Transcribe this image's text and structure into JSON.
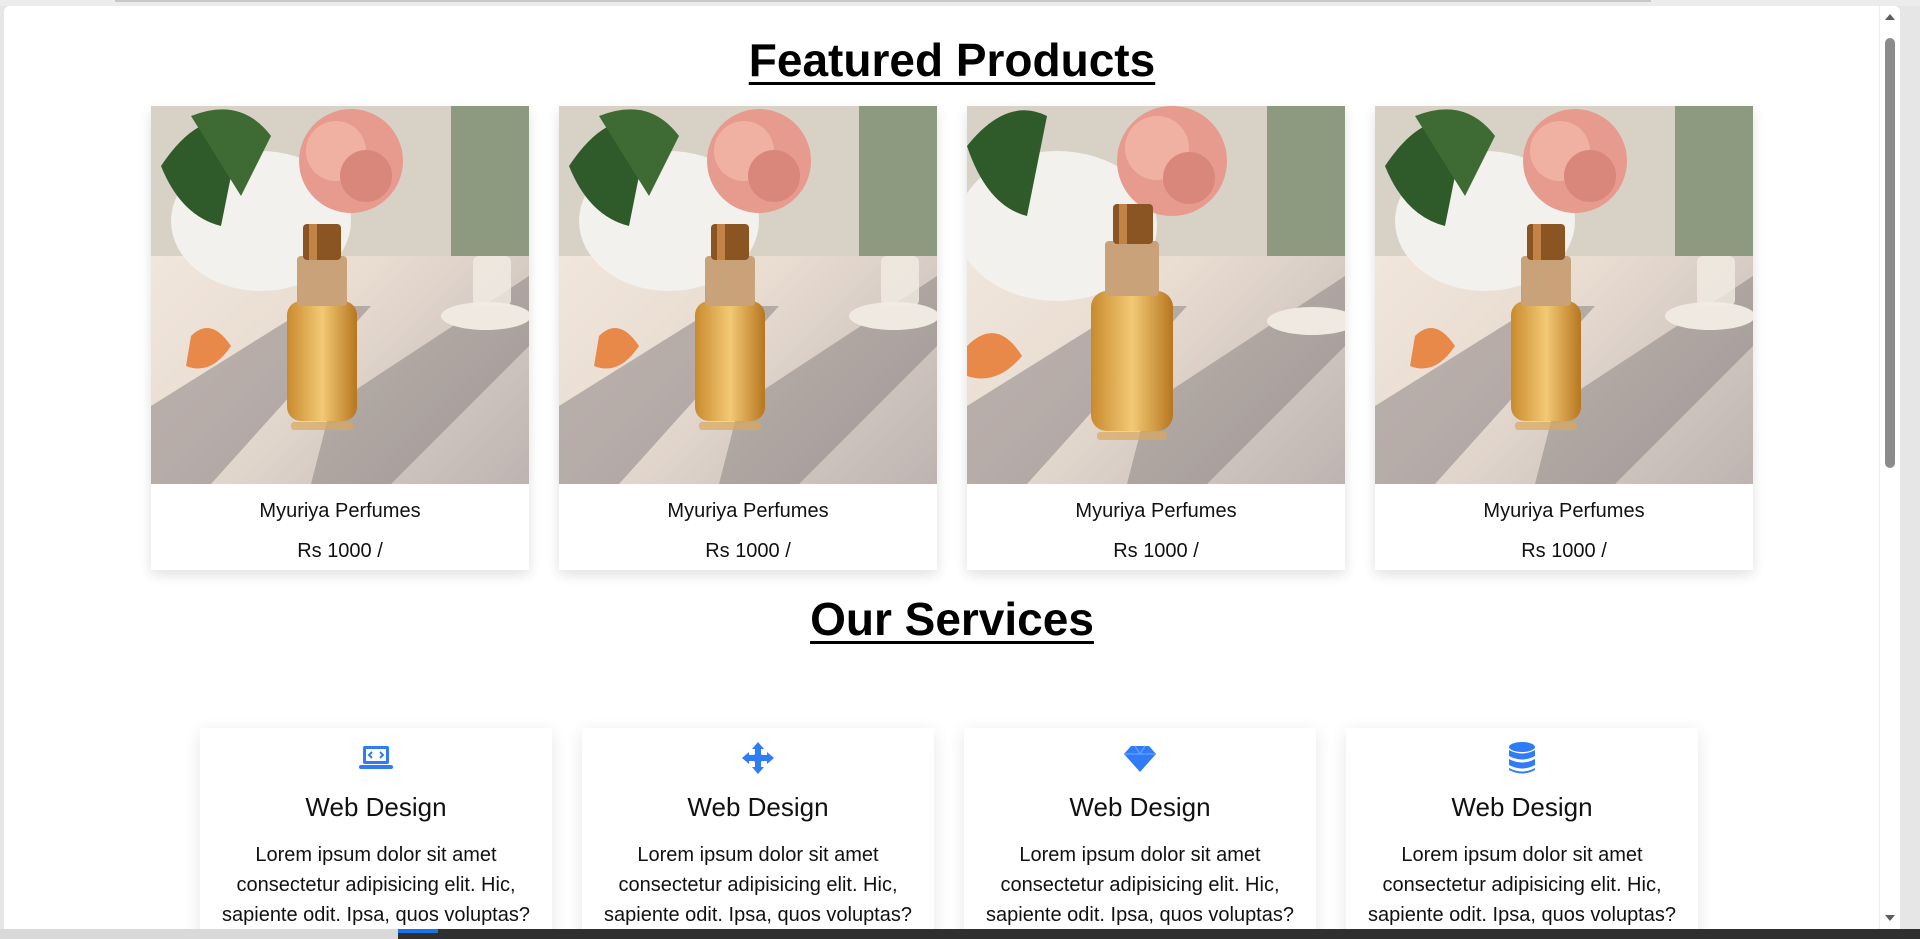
{
  "featured": {
    "title": "Featured Products",
    "products": [
      {
        "name": "Myuriya Perfumes",
        "price": "Rs 1000 /"
      },
      {
        "name": "Myuriya Perfumes",
        "price": "Rs 1000 /"
      },
      {
        "name": "Myuriya Perfumes",
        "price": "Rs 1000 /"
      },
      {
        "name": "Myuriya Perfumes",
        "price": "Rs 1000 /"
      }
    ]
  },
  "services": {
    "title": "Our Services",
    "items": [
      {
        "icon": "laptop-code-icon",
        "title": "Web Design",
        "text": "Lorem ipsum dolor sit amet consectetur adipisicing elit. Hic, sapiente odit. Ipsa, quos voluptas?"
      },
      {
        "icon": "arrows-move-icon",
        "title": "Web Design",
        "text": "Lorem ipsum dolor sit amet consectetur adipisicing elit. Hic, sapiente odit. Ipsa, quos voluptas?"
      },
      {
        "icon": "gem-icon",
        "title": "Web Design",
        "text": "Lorem ipsum dolor sit amet consectetur adipisicing elit. Hic, sapiente odit. Ipsa, quos voluptas?"
      },
      {
        "icon": "database-icon",
        "title": "Web Design",
        "text": "Lorem ipsum dolor sit amet consectetur adipisicing elit. Hic, sapiente odit. Ipsa, quos voluptas?"
      }
    ]
  },
  "colors": {
    "accent": "#2f7cf6",
    "heading": "#000000",
    "text": "#111111"
  }
}
